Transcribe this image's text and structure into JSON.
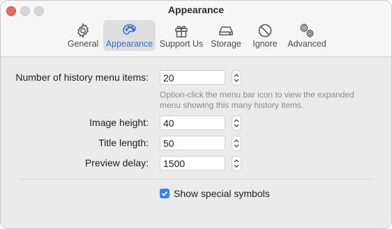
{
  "window": {
    "title": "Appearance"
  },
  "toolbar": {
    "tabs": [
      {
        "label": "General",
        "icon": "gear-icon",
        "selected": false
      },
      {
        "label": "Appearance",
        "icon": "palette-icon",
        "selected": true
      },
      {
        "label": "Support Us",
        "icon": "gift-icon",
        "selected": false
      },
      {
        "label": "Storage",
        "icon": "disk-drive-icon",
        "selected": false
      },
      {
        "label": "Ignore",
        "icon": "prohibited-icon",
        "selected": false
      },
      {
        "label": "Advanced",
        "icon": "gears-icon",
        "selected": false
      }
    ]
  },
  "settings": {
    "history_items": {
      "label": "Number of history menu items:",
      "value": "20"
    },
    "history_help": "Option-click the menu bar icon to view the expanded menu showing this many history items.",
    "image_height": {
      "label": "Image height:",
      "value": "40"
    },
    "title_length": {
      "label": "Title length:",
      "value": "50"
    },
    "preview_delay": {
      "label": "Preview delay:",
      "value": "1500"
    },
    "special_symbols": {
      "label": "Show special symbols",
      "checked": true
    }
  },
  "colors": {
    "accent": "#3a82f7",
    "close_button": "#ed6a5e"
  }
}
